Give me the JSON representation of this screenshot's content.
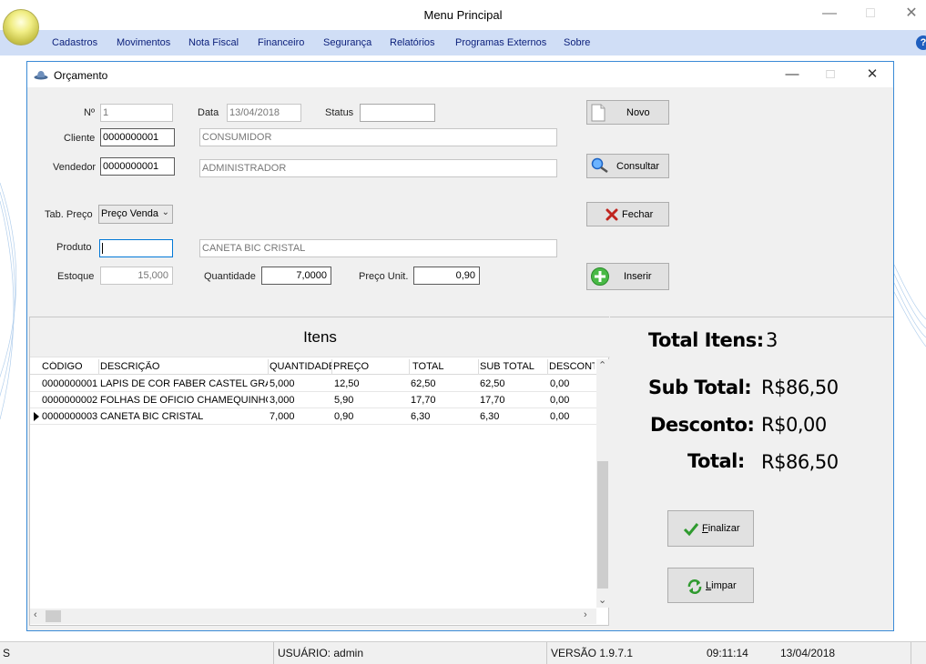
{
  "window": {
    "title": "Menu Principal"
  },
  "menu": {
    "items": [
      "Cadastros",
      "Movimentos",
      "Nota Fiscal",
      "Financeiro",
      "Segurança",
      "Relatórios",
      "Programas Externos",
      "Sobre"
    ],
    "help": "?"
  },
  "form": {
    "title": "Orçamento",
    "labels": {
      "numero": "Nº",
      "data": "Data",
      "status": "Status",
      "cliente": "Cliente",
      "vendedor": "Vendedor",
      "tab_preco": "Tab. Preço",
      "produto": "Produto",
      "estoque": "Estoque",
      "quantidade": "Quantidade",
      "preco_unit": "Preço Unit."
    },
    "values": {
      "numero": "1",
      "data": "13/04/2018",
      "status": "",
      "cliente_codigo": "0000000001",
      "cliente_nome": "CONSUMIDOR",
      "vendedor_codigo": "0000000001",
      "vendedor_nome": "ADMINISTRADOR",
      "tab_preco": "Preço Venda",
      "produto_codigo": "",
      "produto_nome": "CANETA BIC CRISTAL",
      "estoque": "15,000",
      "quantidade": "7,0000",
      "preco_unit": "0,90"
    },
    "buttons": {
      "novo": "Novo",
      "consultar": "Consultar",
      "fechar": "Fechar",
      "inserir": "Inserir"
    }
  },
  "grid": {
    "title": "Itens",
    "columns": [
      "CÓDIGO",
      "DESCRIÇÃO",
      "QUANTIDADE",
      "PREÇO",
      "TOTAL",
      "SUB TOTAL",
      "DESCONT"
    ],
    "rows": [
      [
        "0000000001",
        "LAPIS DE COR FABER CASTEL GRANDE",
        "5,000",
        "12,50",
        "62,50",
        "62,50",
        "0,00"
      ],
      [
        "0000000002",
        "FOLHAS DE OFICIO CHAMEQUINHO C",
        "3,000",
        "5,90",
        "17,70",
        "17,70",
        "0,00"
      ],
      [
        "0000000003",
        "CANETA BIC CRISTAL",
        "7,000",
        "0,90",
        "6,30",
        "6,30",
        "0,00"
      ]
    ]
  },
  "totals": {
    "itens_label": "Total Itens:",
    "itens_value": "3",
    "subtotal_label": "Sub Total:",
    "subtotal_value": "R$86,50",
    "desconto_label": "Desconto:",
    "desconto_value": "R$0,00",
    "total_label": "Total:",
    "total_value": "R$86,50",
    "finalizar_first": "F",
    "finalizar_rest": "inalizar",
    "limpar_first": "L",
    "limpar_rest": "impar"
  },
  "statusbar": {
    "left": "S",
    "usuario": "USUÁRIO: admin",
    "versao": "VERSÃO 1.9.7.1",
    "hora": "09:11:14",
    "data": "13/04/2018"
  },
  "colors": {
    "menubar": "#d0def6",
    "menu_text": "#0a1e7a",
    "child_border": "#3a8ad6",
    "focus": "#0078d7"
  }
}
